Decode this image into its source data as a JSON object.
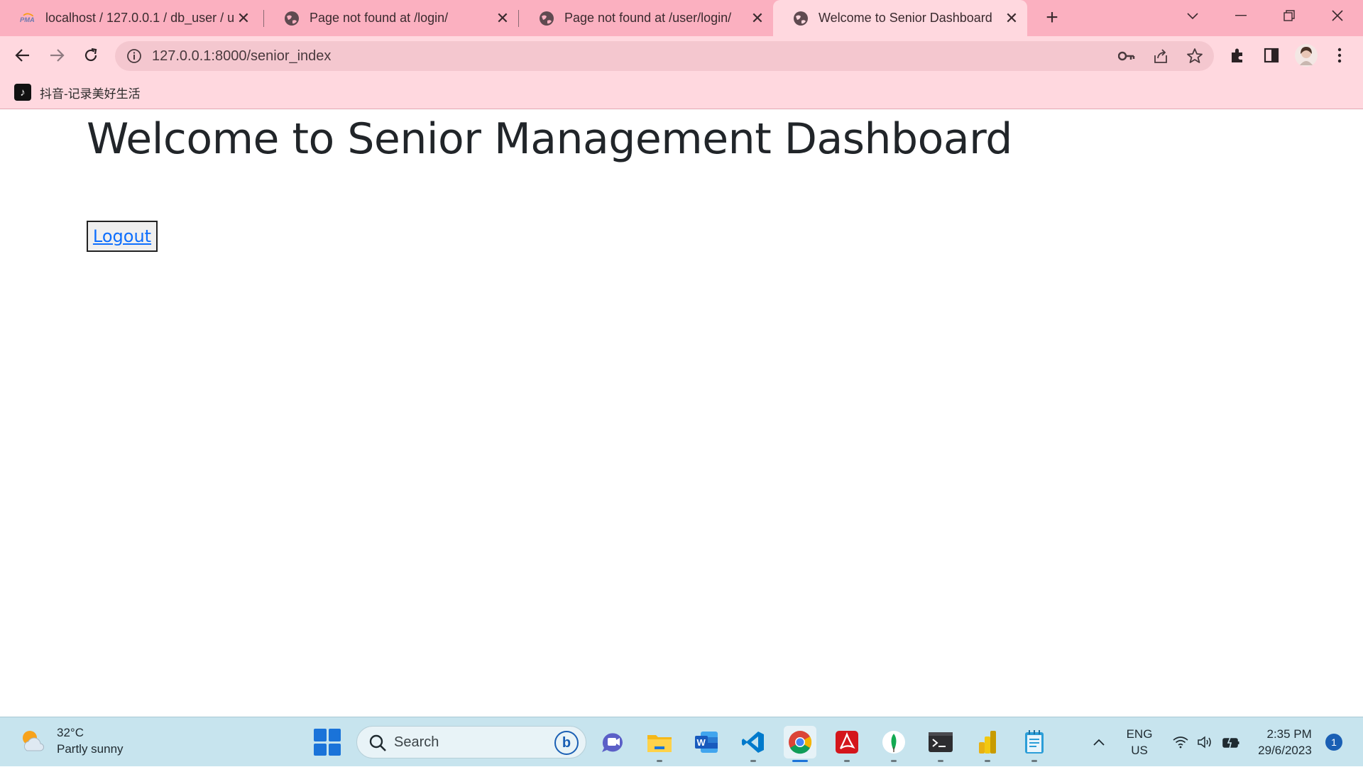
{
  "browser": {
    "tabs": [
      {
        "title": "localhost / 127.0.0.1 / db_user / u",
        "favicon": "phpmyadmin-icon",
        "active": false
      },
      {
        "title": "Page not found at /login/",
        "favicon": "globe-icon",
        "active": false
      },
      {
        "title": "Page not found at /user/login/",
        "favicon": "globe-icon",
        "active": false
      },
      {
        "title": "Welcome to Senior Dashboard",
        "favicon": "globe-icon",
        "active": true
      }
    ],
    "url": "127.0.0.1:8000/senior_index",
    "bookmarks": [
      {
        "label": "抖音-记录美好生活",
        "icon": "tiktok-icon"
      }
    ],
    "colors": {
      "frame": "#fbb0c0",
      "toolbar": "#ffd8df",
      "omnibox": "#f4c7cf"
    }
  },
  "page": {
    "heading": "Welcome to Senior Management Dashboard",
    "logout_label": "Logout",
    "link_color": "#0d6efd"
  },
  "taskbar": {
    "weather": {
      "temp": "32°C",
      "condition": "Partly sunny"
    },
    "search_placeholder": "Search",
    "apps": [
      "teams-icon",
      "file-explorer-icon",
      "word-icon",
      "vscode-icon",
      "chrome-icon",
      "acrobat-icon",
      "mongodb-icon",
      "terminal-icon",
      "powerbi-icon",
      "notepad-icon"
    ],
    "active_app": "chrome-icon",
    "lang_line1": "ENG",
    "lang_line2": "US",
    "time": "2:35 PM",
    "date": "29/6/2023",
    "notifications": "1"
  }
}
